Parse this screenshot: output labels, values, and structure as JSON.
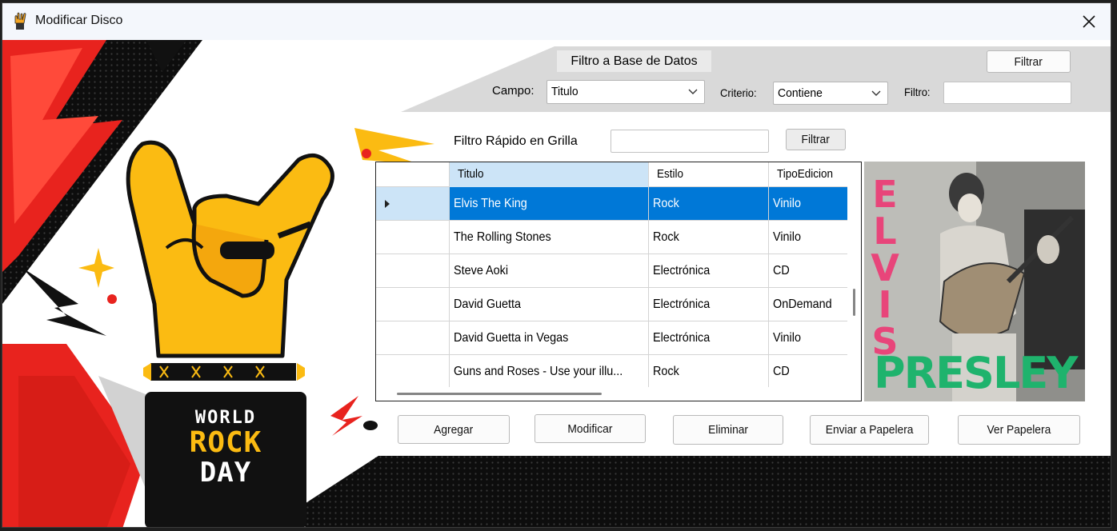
{
  "window": {
    "title": "Modificar Disco",
    "icon": "rock-hand-icon",
    "close_icon": "close-icon"
  },
  "db_filter": {
    "title": "Filtro a Base de Datos",
    "filter_button": "Filtrar",
    "campo_label": "Campo:",
    "campo_value": "Titulo",
    "criterio_label": "Criterio:",
    "criterio_value": "Contiene",
    "filtro_label": "Filtro:",
    "filtro_value": ""
  },
  "quick_filter": {
    "label": "Filtro Rápido en Grilla",
    "value": "",
    "button": "Filtrar"
  },
  "grid": {
    "columns": [
      "Titulo",
      "Estilo",
      "TipoEdicion"
    ],
    "rows": [
      {
        "titulo": "Elvis The King",
        "estilo": "Rock",
        "tipo": "Vinilo",
        "selected": true
      },
      {
        "titulo": "The Rolling Stones",
        "estilo": "Rock",
        "tipo": "Vinilo",
        "selected": false
      },
      {
        "titulo": "Steve Aoki",
        "estilo": "Electrónica",
        "tipo": "CD",
        "selected": false
      },
      {
        "titulo": "David Guetta",
        "estilo": "Electrónica",
        "tipo": "OnDemand",
        "selected": false
      },
      {
        "titulo": "David Guetta in Vegas",
        "estilo": "Electrónica",
        "tipo": "Vinilo",
        "selected": false
      },
      {
        "titulo": "Guns and Roses - Use your illu...",
        "estilo": "Rock",
        "tipo": "CD",
        "selected": false
      }
    ]
  },
  "cover": {
    "line1": "ELVIS",
    "line2": "PRESLEY",
    "pink": "#e8457a",
    "green": "#1fb36d"
  },
  "poster": {
    "line1": "WORLD",
    "line2": "ROCK",
    "line3": "DAY"
  },
  "actions": {
    "agregar": "Agregar",
    "modificar": "Modificar",
    "eliminar": "Eliminar",
    "enviar_papelera": "Enviar a Papelera",
    "ver_papelera": "Ver Papelera"
  },
  "colors": {
    "selection": "#0078d7",
    "red": "#e8231e",
    "yellow": "#fbbb12"
  }
}
